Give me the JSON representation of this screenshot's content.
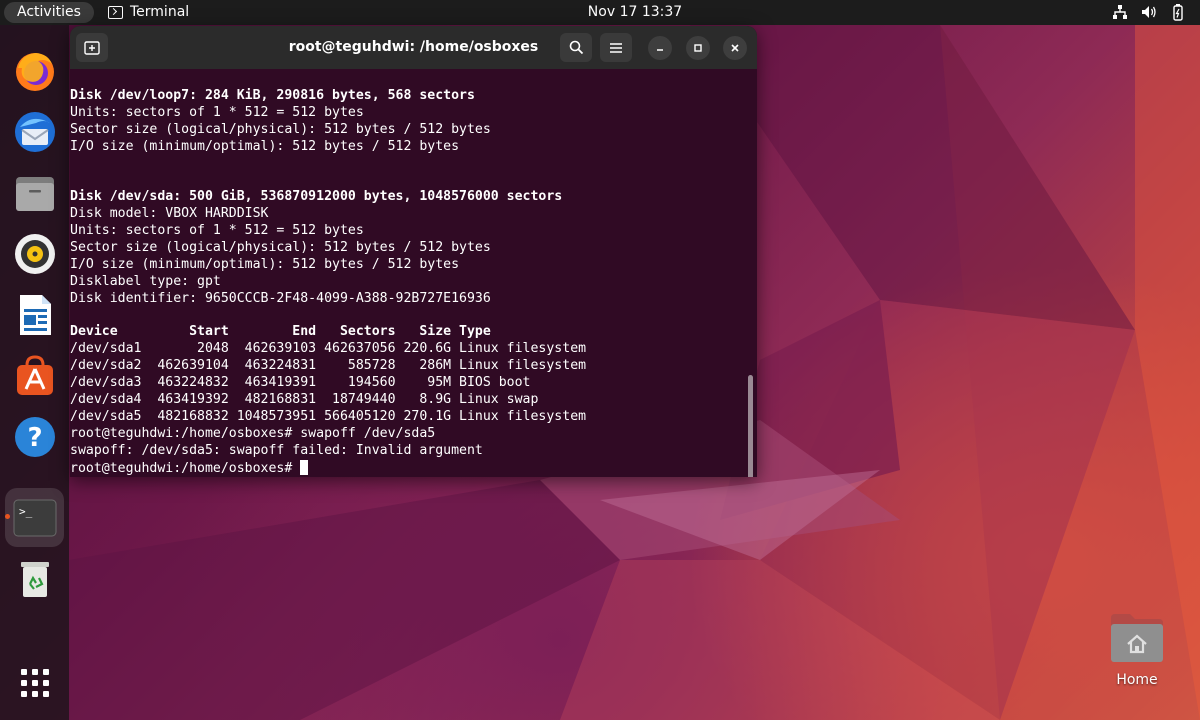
{
  "topbar": {
    "activities": "Activities",
    "app_name": "Terminal",
    "clock": "Nov 17  13:37",
    "tray_icons": [
      "network-icon",
      "volume-icon",
      "battery-icon"
    ]
  },
  "dock": {
    "items": [
      "firefox-icon",
      "thunderbird-icon",
      "files-icon",
      "rhythmbox-icon",
      "writer-icon",
      "app-center-icon",
      "help-icon",
      "terminal-icon",
      "trash-icon",
      "show-apps-icon"
    ],
    "accent_color": "#e95420"
  },
  "terminal": {
    "title": "root@teguhdwi: /home/osboxes",
    "lines": [
      {
        "text": "Disk /dev/loop7: 284 KiB, 290816 bytes, 568 sectors",
        "bold": true
      },
      {
        "text": "Units: sectors of 1 * 512 = 512 bytes",
        "bold": false
      },
      {
        "text": "Sector size (logical/physical): 512 bytes / 512 bytes",
        "bold": false
      },
      {
        "text": "I/O size (minimum/optimal): 512 bytes / 512 bytes",
        "bold": false
      },
      {
        "text": "",
        "bold": false
      },
      {
        "text": "",
        "bold": false
      },
      {
        "text": "Disk /dev/sda: 500 GiB, 536870912000 bytes, 1048576000 sectors",
        "bold": true
      },
      {
        "text": "Disk model: VBOX HARDDISK",
        "bold": false
      },
      {
        "text": "Units: sectors of 1 * 512 = 512 bytes",
        "bold": false
      },
      {
        "text": "Sector size (logical/physical): 512 bytes / 512 bytes",
        "bold": false
      },
      {
        "text": "I/O size (minimum/optimal): 512 bytes / 512 bytes",
        "bold": false
      },
      {
        "text": "Disklabel type: gpt",
        "bold": false
      },
      {
        "text": "Disk identifier: 9650CCCB-2F48-4099-A388-92B727E16936",
        "bold": false
      },
      {
        "text": "",
        "bold": false
      },
      {
        "text": "Device         Start        End   Sectors   Size Type",
        "bold": true
      },
      {
        "text": "/dev/sda1       2048  462639103 462637056 220.6G Linux filesystem",
        "bold": false
      },
      {
        "text": "/dev/sda2  462639104  463224831    585728   286M Linux filesystem",
        "bold": false
      },
      {
        "text": "/dev/sda3  463224832  463419391    194560    95M BIOS boot",
        "bold": false
      },
      {
        "text": "/dev/sda4  463419392  482168831  18749440   8.9G Linux swap",
        "bold": false
      },
      {
        "text": "/dev/sda5  482168832 1048573951 566405120 270.1G Linux filesystem",
        "bold": false
      },
      {
        "text": "root@teguhdwi:/home/osboxes# swapoff /dev/sda5",
        "bold": false
      },
      {
        "text": "swapoff: /dev/sda5: swapoff failed: Invalid argument",
        "bold": false
      }
    ],
    "prompt": "root@teguhdwi:/home/osboxes# ",
    "background": "#300a24"
  },
  "desktop": {
    "home_label": "Home"
  }
}
